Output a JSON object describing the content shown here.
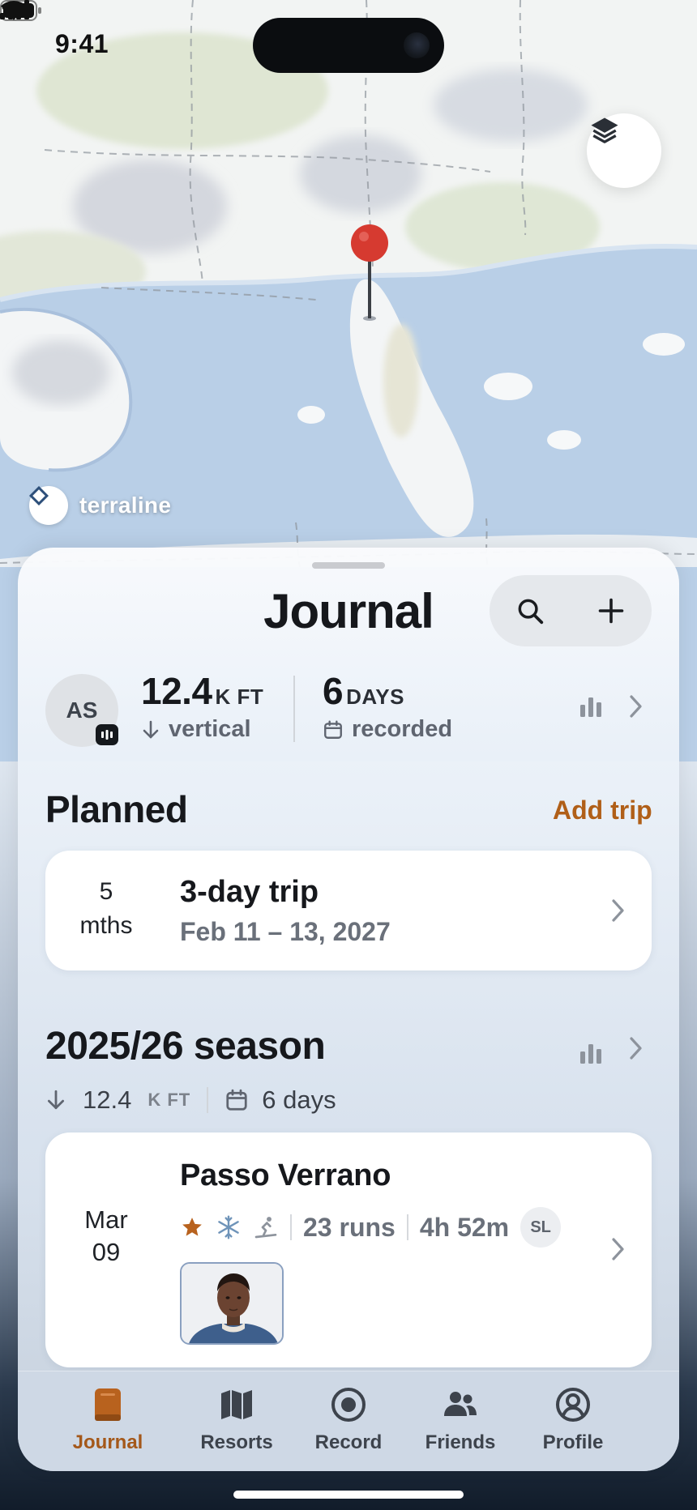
{
  "status_bar": {
    "time": "9:41"
  },
  "map": {
    "brand": "terraline"
  },
  "journal": {
    "title": "Journal",
    "profile": {
      "initials": "AS"
    },
    "stats": {
      "vertical_value": "12.4",
      "vertical_unit": "K FT",
      "vertical_label": "vertical",
      "days_value": "6",
      "days_unit": "DAYS",
      "days_label": "recorded"
    },
    "planned": {
      "title": "Planned",
      "add_label": "Add trip",
      "trip": {
        "countdown_value": "5",
        "countdown_unit": "mths",
        "title": "3-day trip",
        "dates": "Feb 11 – 13, 2027"
      }
    },
    "season": {
      "title": "2025/26 season",
      "vertical_value": "12.4",
      "vertical_unit": "K FT",
      "days": "6 days",
      "day_card": {
        "month": "Mar",
        "day": "09",
        "resort": "Passo Verrano",
        "runs": "23 runs",
        "duration": "4h 52m",
        "level": "SL",
        "photo": "skier-portrait"
      }
    }
  },
  "tab_bar": {
    "tabs": [
      {
        "label": "Journal",
        "icon": "book-icon",
        "active": true
      },
      {
        "label": "Resorts",
        "icon": "map-icon",
        "active": false
      },
      {
        "label": "Record",
        "icon": "record-icon",
        "active": false
      },
      {
        "label": "Friends",
        "icon": "friends-icon",
        "active": false
      },
      {
        "label": "Profile",
        "icon": "profile-icon",
        "active": false
      }
    ]
  },
  "colors": {
    "accent": "#a4581a",
    "add_trip": "#b05f18",
    "water": "#b7cde6",
    "pin": "#d63a30"
  }
}
